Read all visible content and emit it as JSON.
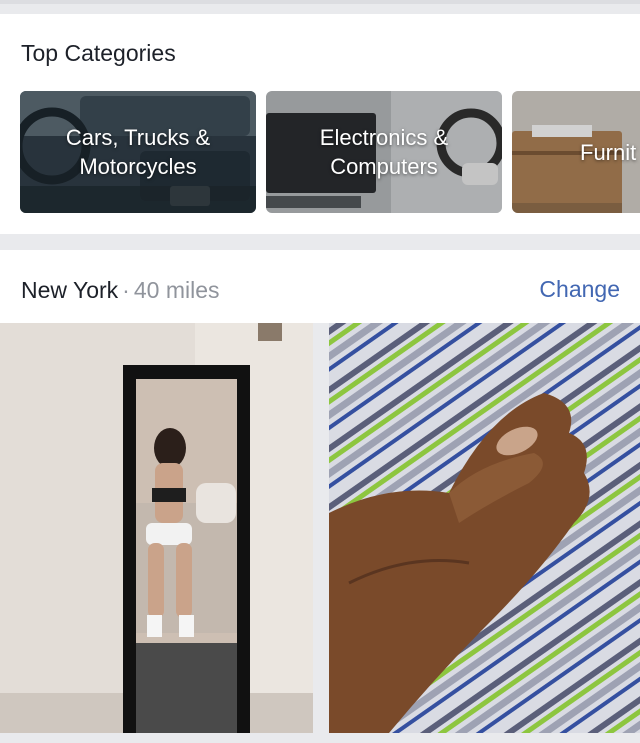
{
  "categories": {
    "title": "Top Categories",
    "items": [
      {
        "label_line1": "Cars, Trucks &",
        "label_line2": "Motorcycles"
      },
      {
        "label_line1": "Electronics &",
        "label_line2": "Computers"
      },
      {
        "label_line1": "Furnit",
        "label_line2": ""
      }
    ]
  },
  "location": {
    "city": "New York",
    "separator": "·",
    "distance": "40 miles",
    "change_label": "Change"
  }
}
